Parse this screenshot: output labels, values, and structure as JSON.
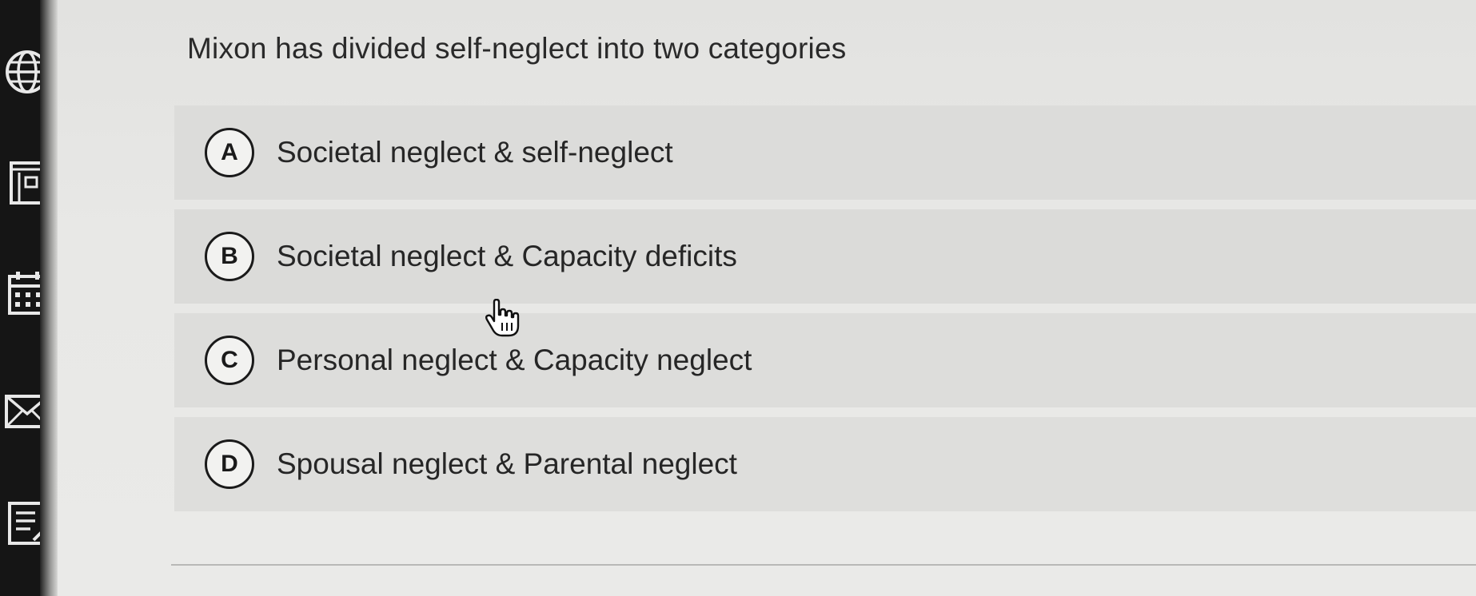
{
  "question": {
    "text": "Mixon has divided self-neglect into two categories"
  },
  "options": [
    {
      "letter": "A",
      "text": "Societal neglect & self-neglect"
    },
    {
      "letter": "B",
      "text": "Societal neglect & Capacity deficits"
    },
    {
      "letter": "C",
      "text": "Personal neglect & Capacity neglect"
    },
    {
      "letter": "D",
      "text": "Spousal neglect & Parental neglect"
    }
  ],
  "sidebar": {
    "icons": [
      "globe-icon",
      "book-icon",
      "calendar-icon",
      "mail-icon",
      "notes-icon"
    ]
  },
  "colors": {
    "sidebar_bg": "#151515",
    "page_bg": "#e4e4e2",
    "option_bg": "#dcdcda",
    "text": "#262626"
  }
}
